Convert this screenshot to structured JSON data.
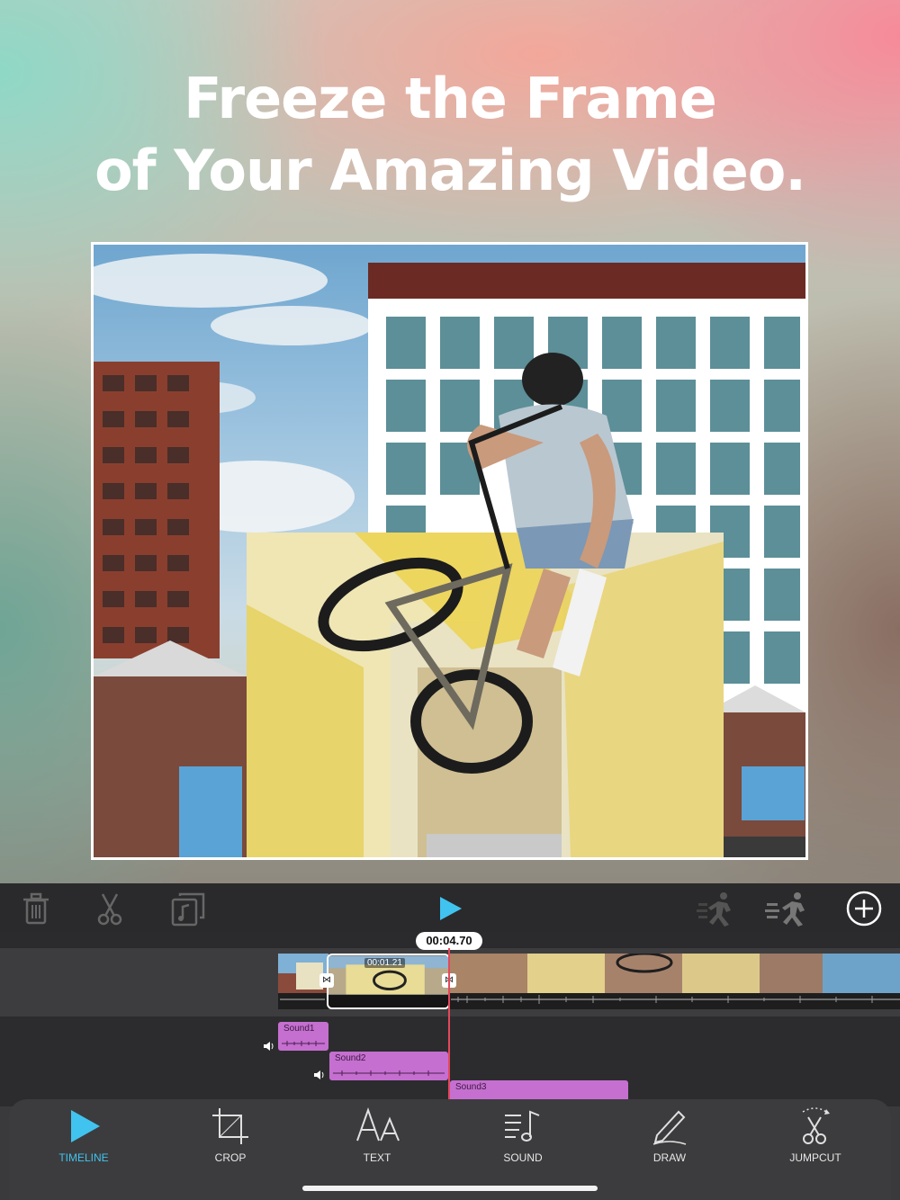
{
  "headline": {
    "line1": "Freeze the Frame",
    "line2": "of Your Amazing Video."
  },
  "toolbar": {
    "delete_icon": "trash-icon",
    "cut_icon": "scissors-icon",
    "extract_audio_icon": "music-note-box-icon",
    "play_icon": "play-icon",
    "slow_motion_icon": "slow-motion-icon",
    "fast_motion_icon": "fast-motion-icon",
    "add_icon": "plus-circle-icon"
  },
  "timeline": {
    "current_time": "00:04.70",
    "selected_clip_duration": "00:01.21",
    "sounds": [
      {
        "label": "Sound1"
      },
      {
        "label": "Sound2"
      },
      {
        "label": "Sound3"
      }
    ]
  },
  "tabs": [
    {
      "label": "TIMELINE",
      "active": true
    },
    {
      "label": "CROP",
      "active": false
    },
    {
      "label": "TEXT",
      "active": false
    },
    {
      "label": "SOUND",
      "active": false
    },
    {
      "label": "DRAW",
      "active": false
    },
    {
      "label": "JUMPCUT",
      "active": false
    }
  ],
  "colors": {
    "accent": "#41c3ef",
    "playhead": "#e5485b",
    "sound_clip": "#c56fd0"
  }
}
